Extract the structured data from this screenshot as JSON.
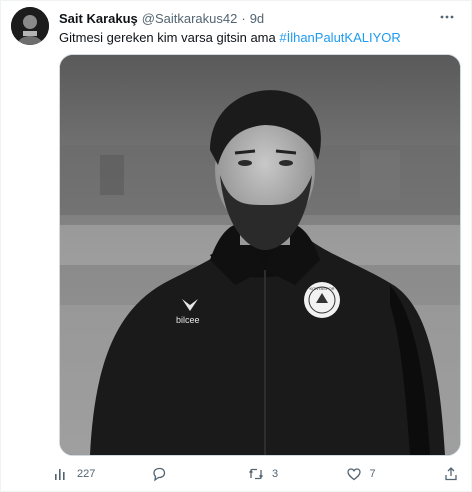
{
  "tweet": {
    "author_name": "Sait Karakuş",
    "author_handle": "@Saitkarakus42",
    "separator": "·",
    "time": "9d",
    "text_plain": "Gitmesi gereken kim varsa gitsin ama ",
    "hashtag": "#İlhanPalutKALIYOR"
  },
  "media": {
    "jacket_brand_text": "bilcee",
    "crest_text": "KONYASPOR"
  },
  "actions": {
    "views_count": "227",
    "reply_count": "",
    "retweet_count": "3",
    "like_count": "7"
  },
  "icons": {
    "more": "more-dots-icon",
    "views": "analytics-bars-icon",
    "reply": "reply-bubble-icon",
    "retweet": "retweet-icon",
    "like": "heart-icon",
    "share": "share-icon"
  },
  "colors": {
    "accent": "#1d9bf0",
    "secondary_text": "#536471",
    "primary_text": "#0f1419"
  }
}
